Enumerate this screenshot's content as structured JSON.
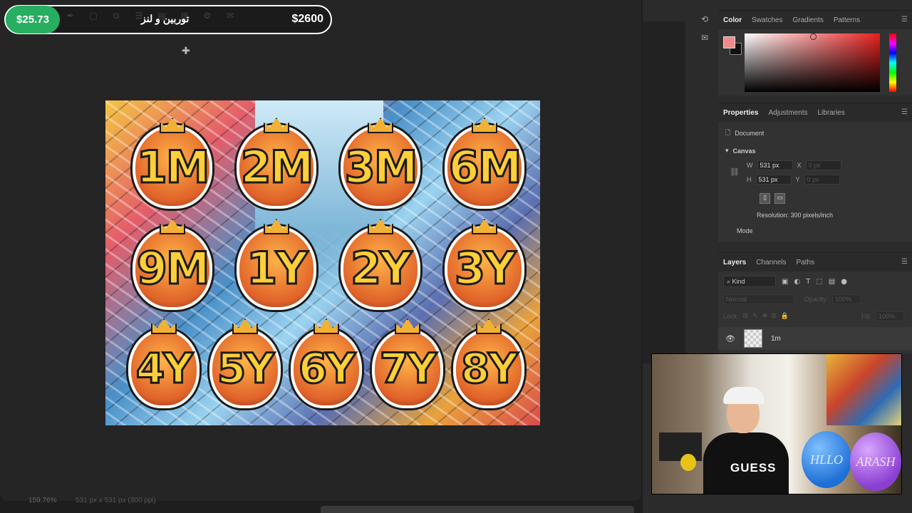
{
  "overlay": {
    "left_price": "$25.73",
    "mid_text": "توربین و لنز",
    "right_price": "$2600"
  },
  "canvas": {
    "badges": {
      "row1": [
        "1M",
        "2M",
        "3M",
        "6M"
      ],
      "row2": [
        "9M",
        "1Y",
        "2Y",
        "3Y"
      ],
      "row3": [
        "4Y",
        "5Y",
        "6Y",
        "7Y",
        "8Y"
      ]
    }
  },
  "status": {
    "zoom": "159.76%",
    "doc_info": "531 px x 531 px (300 ppi)"
  },
  "color_panel": {
    "tabs": [
      "Color",
      "Swatches",
      "Gradients",
      "Patterns"
    ],
    "fg_color": "#f08a8a",
    "bg_color": "#111111"
  },
  "properties_panel": {
    "tabs": [
      "Properties",
      "Adjustments",
      "Libraries"
    ],
    "doc_label": "Document",
    "section": "Canvas",
    "w_label": "W",
    "w_value": "531 px",
    "h_label": "H",
    "h_value": "531 px",
    "x_label": "X",
    "x_value": "0 px",
    "y_label": "Y",
    "y_value": "0 px",
    "resolution": "Resolution: 300 pixels/inch",
    "mode_label": "Mode"
  },
  "layers_panel": {
    "tabs": [
      "Layers",
      "Channels",
      "Paths"
    ],
    "filter_kind": "Kind",
    "blend_mode": "Normal",
    "opacity_label": "Opacity:",
    "opacity_value": "100%",
    "lock_label": "Lock:",
    "fill_label": "Fill:",
    "fill_value": "100%",
    "layer_name": "1m"
  },
  "webcam": {
    "shirt_text": "GUESS",
    "balloon_blue_text": "HLLO",
    "balloon_purple_text": "ARASH"
  }
}
